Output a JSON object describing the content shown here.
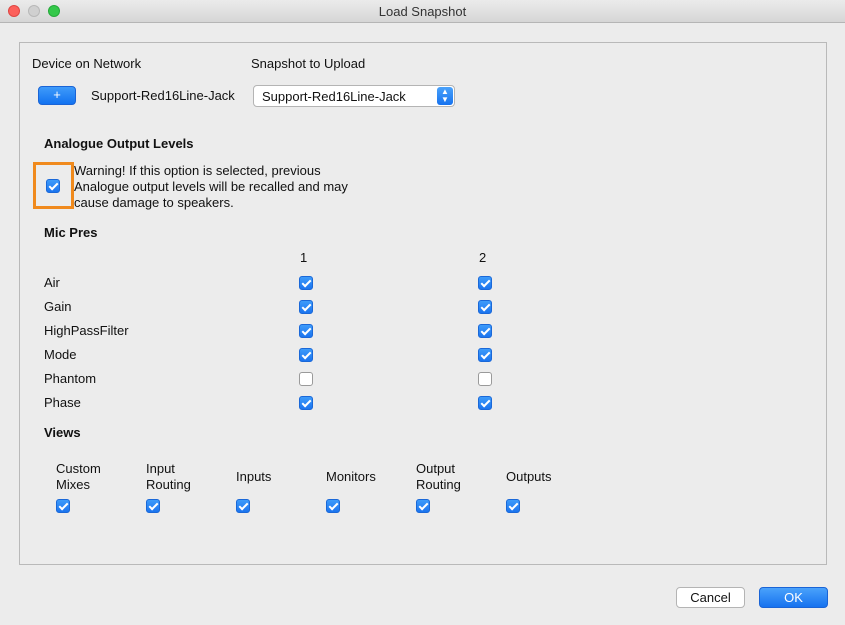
{
  "window": {
    "title": "Load Snapshot"
  },
  "device": {
    "heading": "Device on Network",
    "add_label": "+",
    "name": "Support-Red16Line-Jack"
  },
  "snapshot": {
    "heading": "Snapshot to Upload",
    "selected": "Support-Red16Line-Jack"
  },
  "analogue": {
    "heading": "Analogue Output Levels",
    "checked": true,
    "warning": "Warning! If this option is selected, previous Analogue output levels will be recalled and may cause damage to speakers."
  },
  "mic_pres": {
    "heading": "Mic Pres",
    "columns": [
      "1",
      "2"
    ],
    "rows": [
      {
        "label": "Air",
        "values": [
          true,
          true
        ]
      },
      {
        "label": "Gain",
        "values": [
          true,
          true
        ]
      },
      {
        "label": "HighPassFilter",
        "values": [
          true,
          true
        ]
      },
      {
        "label": "Mode",
        "values": [
          true,
          true
        ]
      },
      {
        "label": "Phantom",
        "values": [
          false,
          false
        ]
      },
      {
        "label": "Phase",
        "values": [
          true,
          true
        ]
      }
    ]
  },
  "views": {
    "heading": "Views",
    "items": [
      {
        "label": "Custom Mixes",
        "checked": true
      },
      {
        "label": "Input Routing",
        "checked": true
      },
      {
        "label": "Inputs",
        "checked": true
      },
      {
        "label": "Monitors",
        "checked": true
      },
      {
        "label": "Output Routing",
        "checked": true
      },
      {
        "label": "Outputs",
        "checked": true
      }
    ]
  },
  "buttons": {
    "cancel": "Cancel",
    "ok": "OK"
  },
  "colors": {
    "accent": "#1b74ef",
    "highlight": "#f08a1d"
  }
}
